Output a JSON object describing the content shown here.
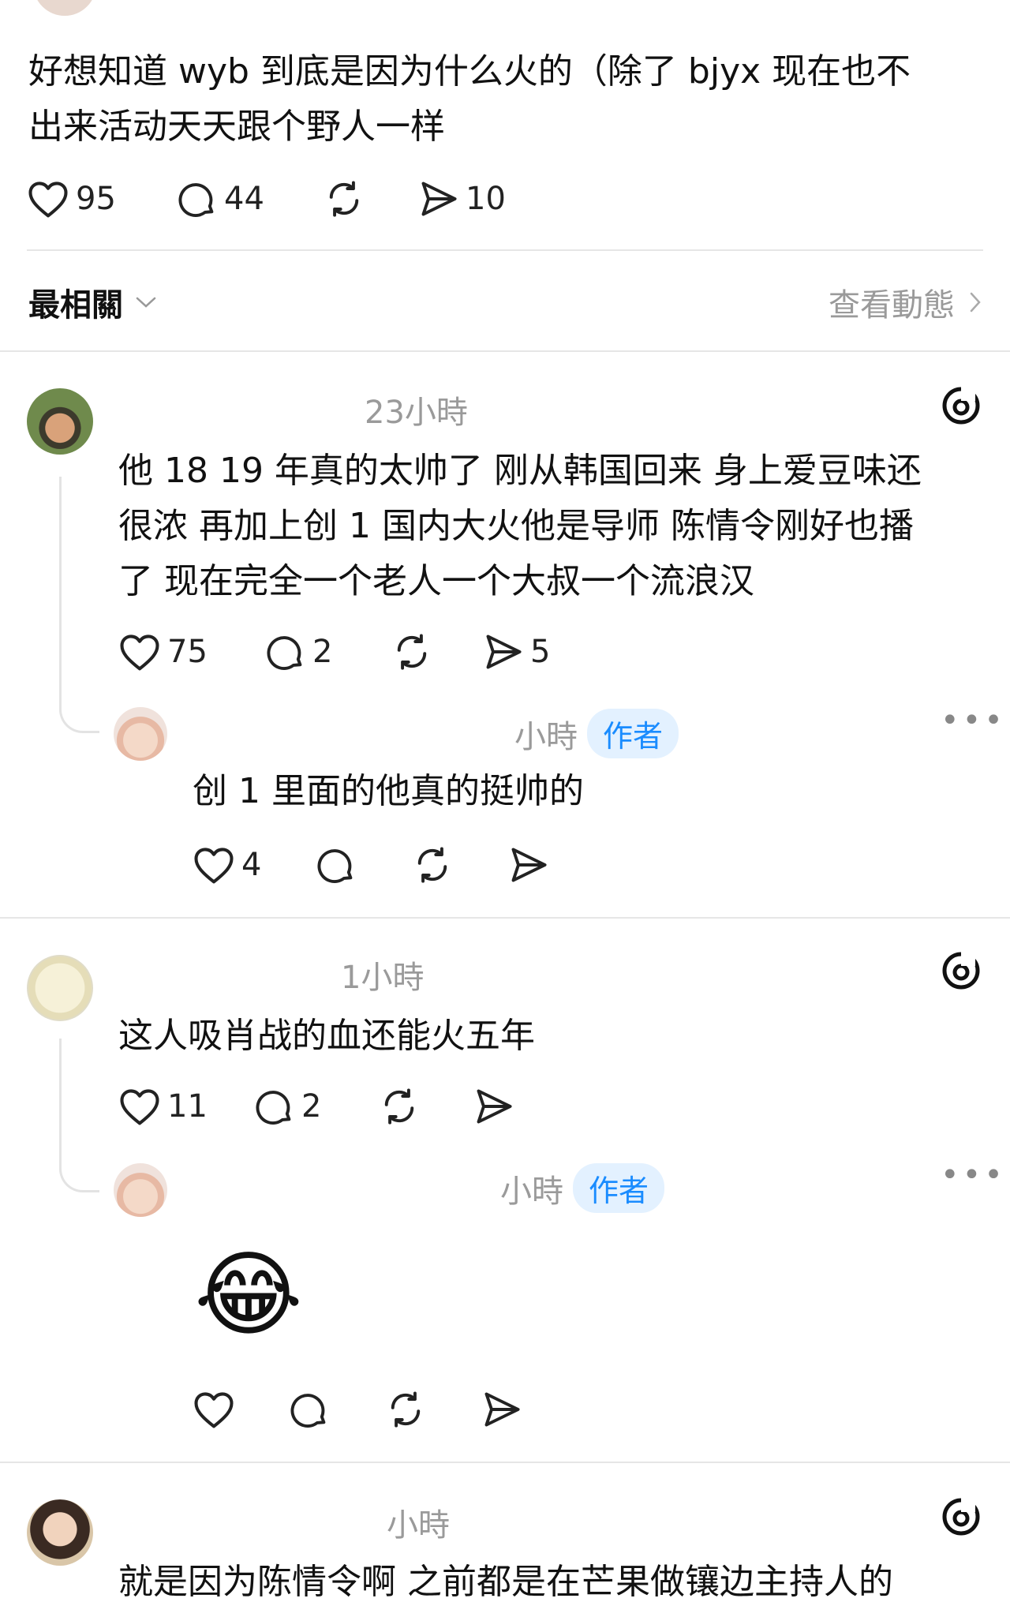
{
  "post": {
    "text_line1": "好想知道 wyb 到底是因为什么火的（除了 bjyx 现在也不",
    "text_line2": "出来活动天天跟个野人一样",
    "likes": "95",
    "comments": "44",
    "shares": "10"
  },
  "sort": {
    "label": "最相關",
    "view_activity": "查看動態"
  },
  "comments": [
    {
      "time": "23小時",
      "lines": [
        "他 18 19 年真的太帅了 刚从韩国回来 身上爱豆味还",
        "很浓 再加上创 1 国内大火他是导师 陈情令刚好也播",
        "了 现在完全一个老人一个大叔一个流浪汉"
      ],
      "likes": "75",
      "comments": "2",
      "shares": "5",
      "reply": {
        "time": "小時",
        "badge": "作者",
        "text": "创 1 里面的他真的挺帅的",
        "likes": "4"
      }
    },
    {
      "time": "1小時",
      "lines": [
        "这人吸肖战的血还能火五年"
      ],
      "likes": "11",
      "comments": "2",
      "reply": {
        "time": "小時",
        "badge": "作者",
        "emoji": "😂"
      }
    },
    {
      "time": "小時",
      "lines": [
        "就是因为陈情令啊 之前都是在芒果做镶边主持人的"
      ]
    }
  ],
  "colors": {
    "badge_bg": "#e3f1ff",
    "badge_text": "#1a8cff",
    "muted": "#9a9a9a"
  }
}
